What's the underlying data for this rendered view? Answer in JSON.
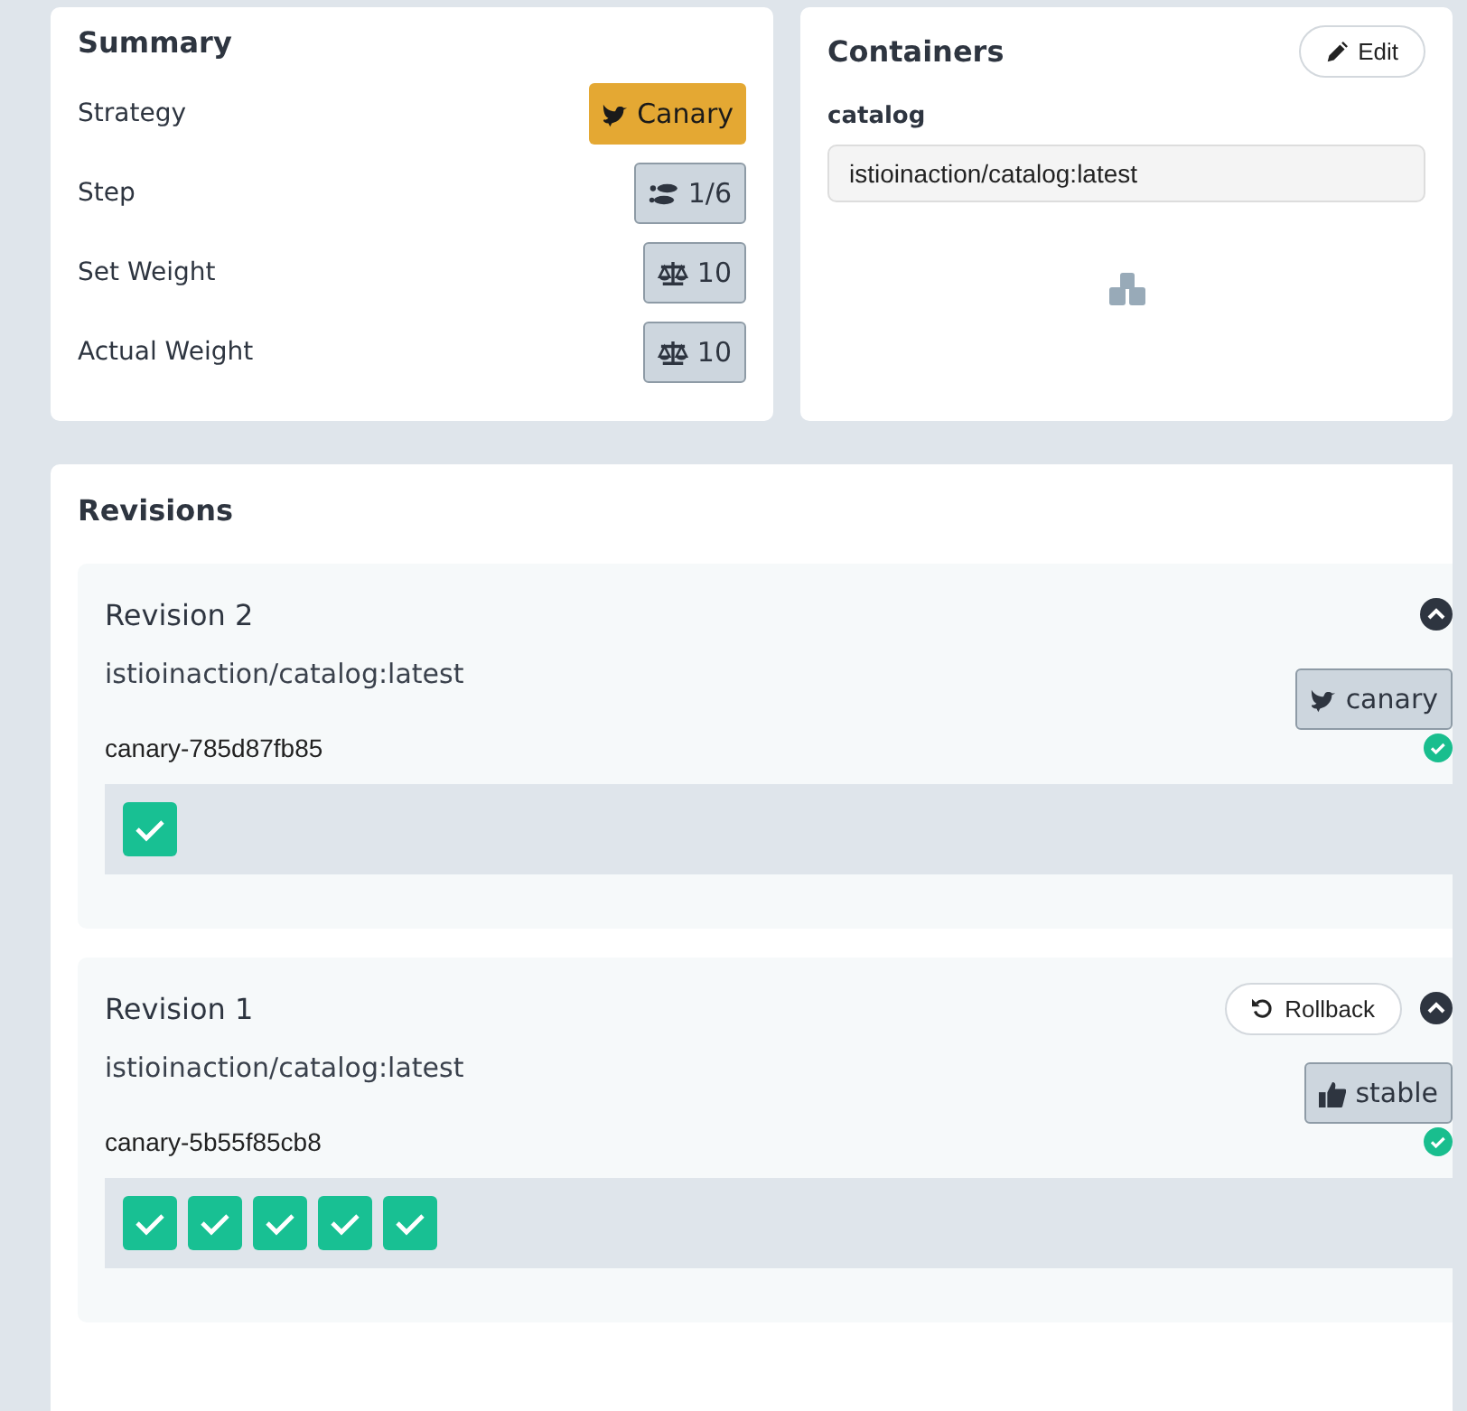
{
  "summary": {
    "title": "Summary",
    "rows": [
      {
        "label": "Strategy",
        "badge": {
          "kind": "strategy",
          "value": "Canary"
        }
      },
      {
        "label": "Step",
        "badge": {
          "kind": "step",
          "value": "1/6"
        }
      },
      {
        "label": "Set Weight",
        "badge": {
          "kind": "weight",
          "value": "10"
        }
      },
      {
        "label": "Actual Weight",
        "badge": {
          "kind": "weight",
          "value": "10"
        }
      }
    ]
  },
  "containers": {
    "title": "Containers",
    "edit_button": "Edit",
    "items": [
      {
        "name": "catalog",
        "image": "istioinaction/catalog:latest"
      }
    ]
  },
  "revisions": {
    "title": "Revisions",
    "items": [
      {
        "title": "Revision 2",
        "expanded": true,
        "image": "istioinaction/catalog:latest",
        "tag": {
          "kind": "canary",
          "label": "canary"
        },
        "replica_set": "canary-785d87fb85",
        "healthy": true,
        "pods": [
          {
            "ready": true
          }
        ]
      },
      {
        "title": "Revision 1",
        "rollback_button": "Rollback",
        "expanded": true,
        "image": "istioinaction/catalog:latest",
        "tag": {
          "kind": "stable",
          "label": "stable"
        },
        "replica_set": "canary-5b55f85cb8",
        "healthy": true,
        "pods": [
          {
            "ready": true
          },
          {
            "ready": true
          },
          {
            "ready": true
          },
          {
            "ready": true
          },
          {
            "ready": true
          }
        ]
      }
    ]
  }
}
